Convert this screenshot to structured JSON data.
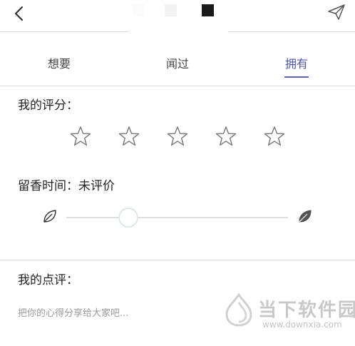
{
  "tabs": [
    {
      "label": "想要",
      "active": false
    },
    {
      "label": "闻过",
      "active": false
    },
    {
      "label": "拥有",
      "active": true
    }
  ],
  "accent_color": "#4d56a5",
  "rating": {
    "label": "我的评分：",
    "max_stars": 5,
    "selected_stars": 0
  },
  "duration": {
    "label": "留香时间：未评价",
    "slider_level_fraction": 0.28,
    "left_icon": "leaf-outline-icon",
    "right_icon": "leaf-filled-icon"
  },
  "review": {
    "label": "我的点评：",
    "placeholder": "把你的心得分享给大家吧...",
    "value": ""
  },
  "watermark": {
    "title": "当下软件园",
    "url": "www.downxia.com"
  }
}
